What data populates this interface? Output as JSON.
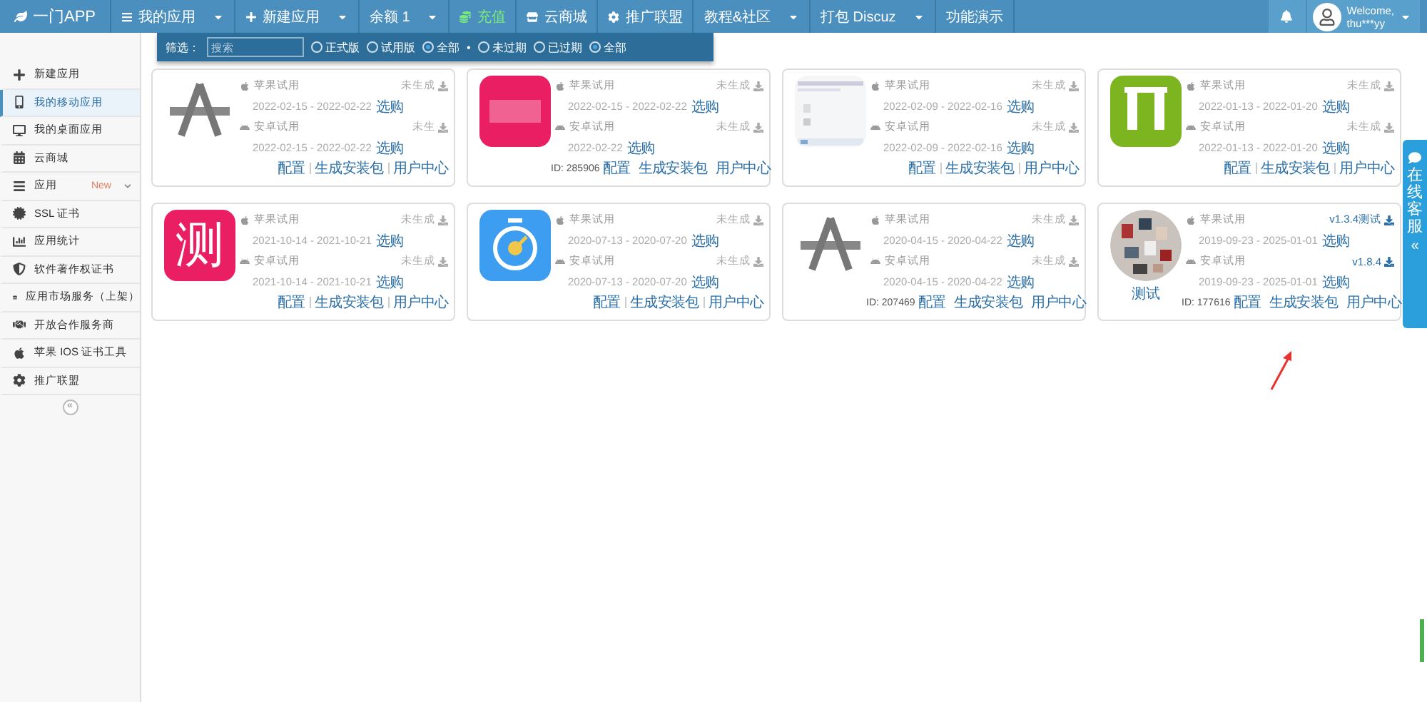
{
  "brand": {
    "name": "一门APP"
  },
  "nav": [
    {
      "label": "我的应用",
      "caret": true,
      "highlight": false
    },
    {
      "label": "新建应用",
      "caret": true,
      "highlight": false
    },
    {
      "label": "余额 1",
      "caret": true,
      "highlight": false
    },
    {
      "label": "充值",
      "caret": false,
      "highlight": true
    },
    {
      "label": "云商城",
      "caret": false,
      "highlight": false
    },
    {
      "label": "推广联盟",
      "caret": false,
      "highlight": false
    },
    {
      "label": "教程&社区",
      "caret": true,
      "highlight": false
    },
    {
      "label": "打包 Discuz",
      "caret": true,
      "highlight": false
    },
    {
      "label": "功能演示",
      "caret": false,
      "highlight": false
    }
  ],
  "user": {
    "greeting": "Welcome,",
    "name": "thu***yy"
  },
  "filter": {
    "label": "筛选：",
    "placeholder": "搜索",
    "separator": "•",
    "groups": [
      [
        {
          "label": "正式版",
          "selected": false
        },
        {
          "label": "试用版",
          "selected": false
        },
        {
          "label": "全部",
          "selected": true
        }
      ],
      [
        {
          "label": "未过期",
          "selected": false
        },
        {
          "label": "已过期",
          "selected": false
        },
        {
          "label": "全部",
          "selected": true
        }
      ]
    ]
  },
  "sidebar": {
    "items": [
      {
        "label": "新建应用",
        "selected": false
      },
      {
        "label": "我的移动应用",
        "selected": true
      },
      {
        "label": "我的桌面应用",
        "selected": false
      },
      {
        "label": "云商城",
        "selected": false
      },
      {
        "label": "应用",
        "selected": false,
        "badge": "New"
      },
      {
        "label": "SSL 证书",
        "selected": false
      },
      {
        "label": "应用统计",
        "selected": false
      },
      {
        "label": "软件著作权证书",
        "selected": false
      },
      {
        "label": "应用市场服务（上架）",
        "selected": false
      },
      {
        "label": "开放合作服务商",
        "selected": false
      },
      {
        "label": "苹果 IOS 证书工具",
        "selected": false
      },
      {
        "label": "推广联盟",
        "selected": false
      }
    ],
    "collapse": "«"
  },
  "apps": [
    {
      "kind": "appstore",
      "ios": {
        "label": "苹果试用",
        "dates": "2022-02-15 - 2022-02-22",
        "buy": "选购",
        "status": "未生成",
        "built": false
      },
      "android": {
        "label": "安卓试用",
        "dates": "2022-02-15 - 2022-02-22",
        "buy": "选购",
        "status": "未生",
        "built": false
      },
      "actions": [
        "配置",
        "生成安装包",
        "用户中心"
      ]
    },
    {
      "kind": "pink",
      "id": "ID: 285906",
      "ios": {
        "label": "苹果试用",
        "dates": "2022-02-15 - 2022-02-22",
        "buy": "选购",
        "status": "未生成",
        "built": false
      },
      "android": {
        "label": "安卓试用",
        "dates": "2022-02-22",
        "buy": "选购",
        "status": "未生成",
        "built": false
      },
      "actions": [
        "配置",
        "生成安装包",
        "用户中心"
      ]
    },
    {
      "kind": "screenshot",
      "ios": {
        "label": "苹果试用",
        "dates": "2022-02-09 - 2022-02-16",
        "buy": "选购",
        "status": "未生成",
        "built": false
      },
      "android": {
        "label": "安卓试用",
        "dates": "2022-02-09 - 2022-02-16",
        "buy": "选购",
        "status": "未生成",
        "built": false
      },
      "actions": [
        "配置",
        "生成安装包",
        "用户中心"
      ]
    },
    {
      "kind": "green",
      "ios": {
        "label": "苹果试用",
        "dates": "2022-01-13 - 2022-01-20",
        "buy": "选购",
        "status": "未生成",
        "built": false
      },
      "android": {
        "label": "安卓试用",
        "dates": "2022-01-13 - 2022-01-20",
        "buy": "选购",
        "status": "未生成",
        "built": false
      },
      "actions": [
        "配置",
        "生成安装包",
        "用户中心"
      ]
    },
    {
      "kind": "glyph",
      "glyph": "测",
      "ios": {
        "label": "苹果试用",
        "dates": "2021-10-14 - 2021-10-21",
        "buy": "选购",
        "status": "未生成",
        "built": false
      },
      "android": {
        "label": "安卓试用",
        "dates": "2021-10-14 - 2021-10-21",
        "buy": "选购",
        "status": "未生成",
        "built": false
      },
      "actions": [
        "配置",
        "生成安装包",
        "用户中心"
      ]
    },
    {
      "kind": "stopwatch",
      "ios": {
        "label": "苹果试用",
        "dates": "2020-07-13 - 2020-07-20",
        "buy": "选购",
        "status": "未生成",
        "built": false
      },
      "android": {
        "label": "安卓试用",
        "dates": "2020-07-13 - 2020-07-20",
        "buy": "选购",
        "status": "未生成",
        "built": false
      },
      "actions": [
        "配置",
        "生成安装包",
        "用户中心"
      ]
    },
    {
      "kind": "appstore",
      "id": "ID: 207469",
      "ios": {
        "label": "苹果试用",
        "dates": "2020-04-15 - 2020-04-22",
        "buy": "选购",
        "status": "未生成",
        "built": false
      },
      "android": {
        "label": "安卓试用",
        "dates": "2020-04-15 - 2020-04-22",
        "buy": "选购",
        "status": "未生成",
        "built": false
      },
      "actions": [
        "配置",
        "生成安装包",
        "用户中心"
      ]
    },
    {
      "kind": "picture",
      "name": "测试",
      "id": "ID: 177616",
      "ios": {
        "label": "苹果试用",
        "dates": "2019-09-23 - 2025-01-01",
        "buy": "选购",
        "status": "v1.3.4测试",
        "built": true
      },
      "android": {
        "label": "安卓试用",
        "dates": "2019-09-23 - 2025-01-01",
        "buy": "选购",
        "status": "v1.8.4",
        "built": true
      },
      "actions": [
        "配置",
        "生成安装包",
        "用户中心"
      ]
    }
  ],
  "support": {
    "label": "在线客服",
    "collapse": "«"
  }
}
